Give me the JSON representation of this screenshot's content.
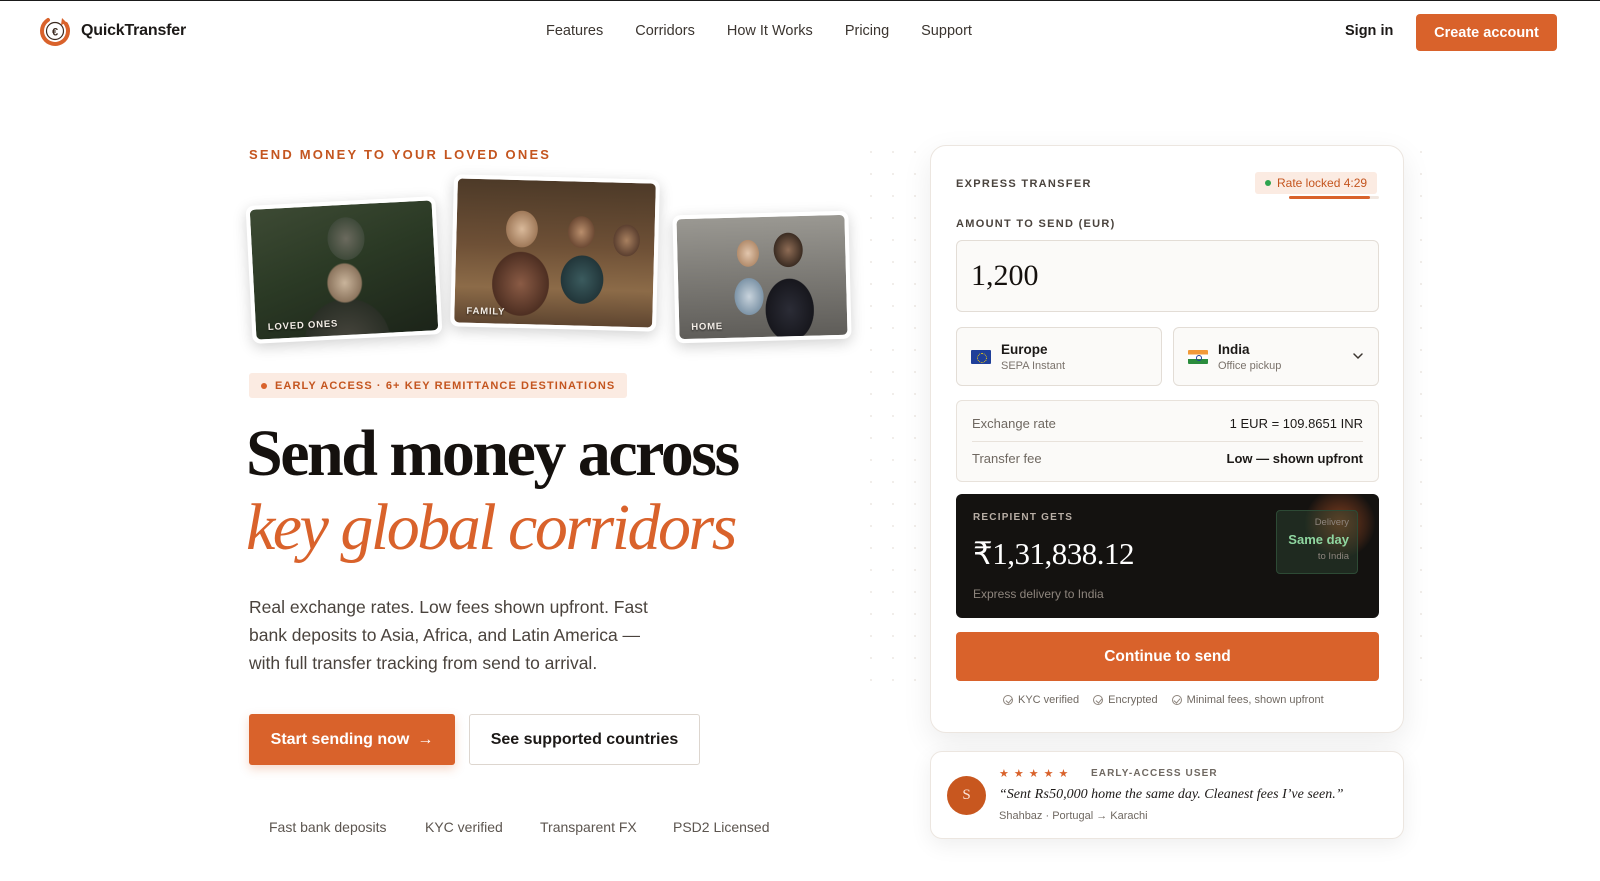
{
  "brand": {
    "name": "QuickTransfer",
    "accent": "#d9622b"
  },
  "nav": {
    "links": [
      "Features",
      "Corridors",
      "How It Works",
      "Pricing",
      "Support"
    ],
    "signin": "Sign in",
    "create_account": "Create account"
  },
  "hero": {
    "eyebrow": "SEND MONEY TO YOUR LOVED ONES",
    "photos": [
      {
        "caption": "LOVED ONES"
      },
      {
        "caption": "FAMILY"
      },
      {
        "caption": "HOME"
      }
    ],
    "badge": "EARLY ACCESS · 6+ KEY REMITTANCE DESTINATIONS",
    "headline_1": "Send money across",
    "headline_2": "key global corridors",
    "lede": "Real exchange rates. Low fees shown upfront. Fast bank deposits to Asia, Africa, and Latin America — with full transfer tracking from send to arrival.",
    "cta_primary": "Start sending now",
    "cta_primary_arrow": "→",
    "cta_secondary": "See supported countries",
    "trust": [
      "Fast bank deposits",
      "KYC verified",
      "Transparent FX",
      "PSD2 Licensed"
    ]
  },
  "transfer": {
    "label": "EXPRESS TRANSFER",
    "rate_lock": "Rate locked 4:29",
    "rate_lock_progress": 0.9,
    "amount_label": "AMOUNT TO SEND (EUR)",
    "amount_value": "1,200",
    "from": {
      "name": "Europe",
      "sub": "SEPA Instant",
      "flag": "eu-flag"
    },
    "to": {
      "name": "India",
      "sub": "Office pickup",
      "flag": "india-flag"
    },
    "exchange_rate_label": "Exchange rate",
    "exchange_rate_value": "1 EUR = 109.8651 INR",
    "fee_label": "Transfer fee",
    "fee_value": "Low — shown upfront",
    "recipient_label": "RECIPIENT GETS",
    "recipient_amount": "₹1,31,838.12",
    "recipient_sub": "Express delivery to India",
    "delivery_top": "Delivery",
    "delivery_main": "Same day",
    "delivery_bottom": "to India",
    "continue": "Continue to send",
    "trust": [
      "KYC verified",
      "Encrypted",
      "Minimal fees, shown upfront"
    ]
  },
  "testimonial": {
    "avatar_initial": "S",
    "stars": "★★★★★",
    "tag": "EARLY-ACCESS USER",
    "quote": "“Sent ₨50,000 home the same day. Cleanest fees I’ve seen.”",
    "author": "Shahbaz · Portugal → Karachi"
  }
}
